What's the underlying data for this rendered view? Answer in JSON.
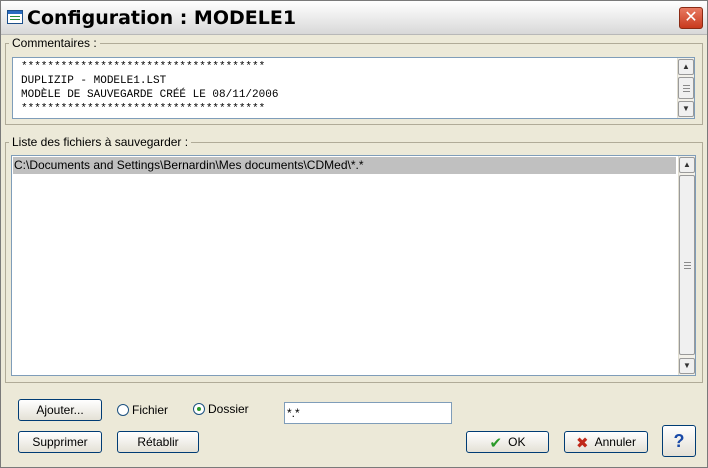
{
  "window": {
    "title": "Configuration : MODELE1",
    "close_label": "✕"
  },
  "comments": {
    "label": "Commentaires :",
    "lines": [
      "*************************************",
      "DUPLIZIP - MODELE1.LST",
      "MODÈLE DE SAUVEGARDE CRÉÉ LE 08/11/2006",
      "*************************************"
    ]
  },
  "files": {
    "label": "Liste des fichiers à sauvegarder :",
    "items": [
      "C:\\Documents and Settings\\Bernardin\\Mes documents\\CDMed\\*.*"
    ]
  },
  "controls": {
    "add_button": "Ajouter...",
    "delete_button": "Supprimer",
    "restore_button": "Rétablir",
    "radio_file": "Fichier",
    "radio_folder": "Dossier",
    "selected_radio": "Dossier",
    "mask_value": "*.*",
    "ok_button": "OK",
    "cancel_button": "Annuler",
    "help_button": "?"
  },
  "colors": {
    "ok_check": "#2a9a2a",
    "cancel_x": "#c0281a",
    "help": "#1a4aa8",
    "selected_row": "#c0c0c0"
  },
  "icons": [
    "app-icon",
    "close-icon",
    "check-icon",
    "cross-icon",
    "help-icon",
    "scroll-up-icon",
    "scroll-down-icon"
  ]
}
